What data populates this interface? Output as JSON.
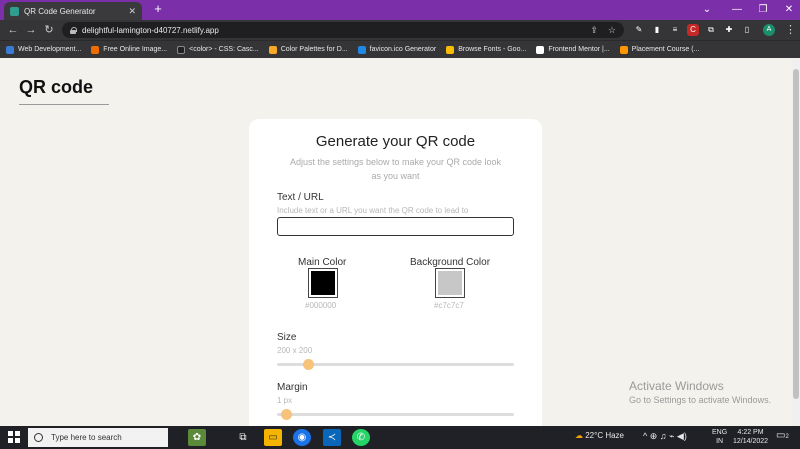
{
  "browser": {
    "tab_title": "QR Code Generator",
    "tab_close": "✕",
    "new_tab": "+",
    "url": "delightful-lamington-d40727.netlify.app",
    "profile_initial": "A",
    "window_controls": [
      "⌄",
      "—",
      "❐",
      "✕"
    ],
    "nav": {
      "back": "←",
      "forward": "→",
      "reload": "↻"
    },
    "omnibox_icons": [
      "⇪",
      "☆"
    ],
    "extensions": [
      {
        "icon": "pen-icon",
        "color": "#4a4a4e"
      },
      {
        "icon": "sample-icon",
        "color": "#7a5bbd"
      },
      {
        "icon": "equalizer-icon",
        "color": "#4a4a4e"
      },
      {
        "icon": "cj-icon",
        "color": "#c62828"
      },
      {
        "icon": "copy-icon",
        "color": "#4a4a4e"
      },
      {
        "icon": "puzzle-icon",
        "color": "#4a4a4e"
      },
      {
        "icon": "sidebar-icon",
        "color": "#4a4a4e"
      }
    ],
    "bookmarks": [
      {
        "label": "Web Development...",
        "color": "#3a7bd5"
      },
      {
        "label": "Free Online Image...",
        "color": "#ef6c00"
      },
      {
        "label": "<color> - CSS: Casc...",
        "color": "#222222"
      },
      {
        "label": "Color Palettes for D...",
        "color": "#f9a825"
      },
      {
        "label": "favicon.ico Generator",
        "color": "#1e88e5"
      },
      {
        "label": "Browse Fonts - Goo...",
        "color": "#fbbc04"
      },
      {
        "label": "Frontend Mentor |...",
        "color": "#ffffff"
      },
      {
        "label": "Placement Course (...",
        "color": "#ff9800"
      }
    ]
  },
  "page": {
    "site_title": "QR code",
    "card": {
      "title": "Generate your QR code",
      "subtitle": "Adjust the settings below to make your QR code look as you want",
      "text_label": "Text / URL",
      "text_hint": "Include text or a URL you want the QR code to lead to",
      "text_value": "",
      "main_color_label": "Main Color",
      "main_color_value": "#000000",
      "main_color_hex": "#000000",
      "bg_color_label": "Background Color",
      "bg_color_value": "#c7c7c7",
      "bg_color_hex": "#c7c7c7",
      "size_label": "Size",
      "size_value": "200 x 200",
      "size_slider_fraction": 0.13,
      "margin_label": "Margin",
      "margin_value": "1 px",
      "margin_slider_fraction": 0.04
    },
    "watermark": {
      "title": "Activate Windows",
      "subtitle": "Go to Settings to activate Windows."
    }
  },
  "taskbar": {
    "search_placeholder": "Type here to search",
    "apps": [
      {
        "icon": "pinned-art-icon",
        "color": "#5b8a3a"
      },
      {
        "icon": "task-view-icon",
        "color": "transparent"
      },
      {
        "icon": "file-explorer-icon",
        "color": "#f4b400"
      },
      {
        "icon": "chrome-icon",
        "color": "#1a73e8"
      },
      {
        "icon": "vscode-icon",
        "color": "#0a66b8"
      },
      {
        "icon": "whatsapp-icon",
        "color": "#25d366"
      }
    ],
    "weather": "22°C  Haze",
    "tray_icons": "^ ⊕ ♫ ⌁ ◀)",
    "language": "ENG",
    "region": "IN",
    "time": "4:22 PM",
    "date": "12/14/2022",
    "notification_count": "2"
  }
}
